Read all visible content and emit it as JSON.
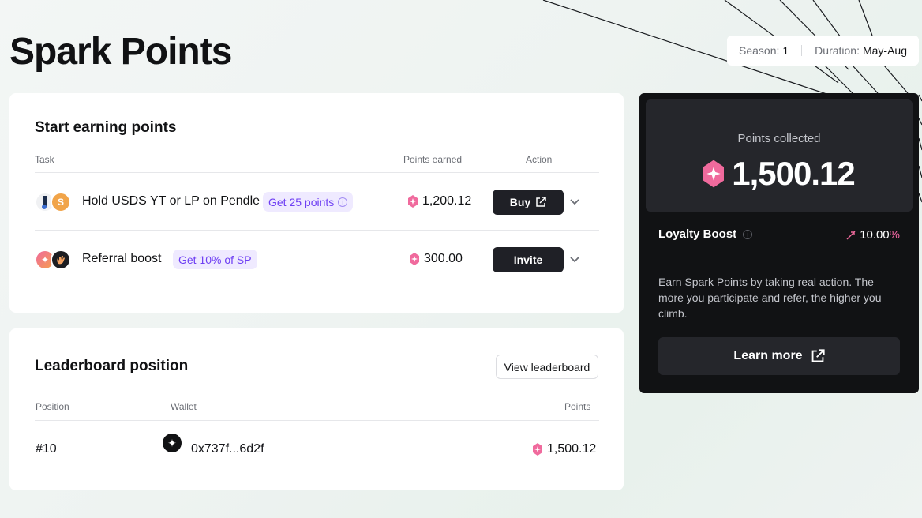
{
  "page": {
    "title": "Spark Points"
  },
  "season": {
    "season_label": "Season:",
    "season_value": "1",
    "duration_label": "Duration:",
    "duration_value": "May-Aug"
  },
  "tasks": {
    "title": "Start earning points",
    "headers": {
      "task": "Task",
      "points": "Points earned",
      "action": "Action"
    },
    "rows": [
      {
        "label": "Hold USDS YT or LP on Pendle",
        "pill": "Get 25 points",
        "points": "1,200.12",
        "action": "Buy",
        "icons": [
          "pendle-icon",
          "usds-icon"
        ]
      },
      {
        "label": "Referral boost",
        "pill": "Get 10% of SP",
        "points": "300.00",
        "action": "Invite",
        "icons": [
          "spark-icon",
          "wave-hand-icon"
        ]
      }
    ]
  },
  "leaderboard": {
    "title": "Leaderboard position",
    "view_button": "View leaderboard",
    "headers": {
      "position": "Position",
      "wallet": "Wallet",
      "points": "Points"
    },
    "row": {
      "position": "#10",
      "wallet": "0x737f...6d2f",
      "points": "1,500.12"
    }
  },
  "summary": {
    "collected_label": "Points collected",
    "collected_value": "1,500.12",
    "loyalty_label": "Loyalty Boost",
    "loyalty_value": "10.00",
    "loyalty_pct": "%",
    "description": "Earn Spark Points by taking real action. The more you participate and refer, the higher you climb.",
    "learn_more": "Learn more"
  },
  "colors": {
    "accent": "#6e3ff3",
    "pill_bg": "#efeaff",
    "gem": "#f06a9d",
    "dark": "#111214",
    "button": "#1f2026"
  }
}
